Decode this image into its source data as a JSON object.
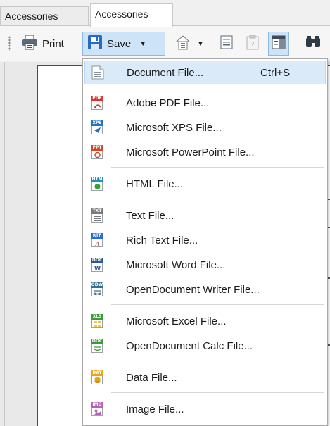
{
  "tabs": [
    {
      "label": "Accessories",
      "active": false
    },
    {
      "label": "Accessories",
      "active": true
    }
  ],
  "toolbar": {
    "print_label": "Print",
    "save_label": "Save",
    "icons": [
      "printer-icon",
      "save-disk-icon",
      "chevron-down-icon",
      "export-home-icon",
      "chevron-down-icon",
      "document-view-icon",
      "paste-icon",
      "page-layout-icon",
      "find-binoculars-icon"
    ]
  },
  "colors": {
    "accent_hover": "#dbeaf9",
    "accent_border": "#8fb8e0",
    "pdf": "#d9342b",
    "xps": "#1e72c9",
    "ppt": "#d24726",
    "htm": "#1f8fc4",
    "txt": "#7a7a7a",
    "rtf": "#2d6bd1",
    "doc": "#2b5797",
    "odw": "#3c6e91",
    "xls": "#3d9a3a",
    "odc": "#3d9a3a",
    "dat": "#e8a317",
    "img": "#b85fb6"
  },
  "save_menu": {
    "items": [
      {
        "label": "Document File...",
        "shortcut": "Ctrl+S",
        "icon": "document-file-icon",
        "tag": ""
      },
      {
        "label": "Adobe PDF File...",
        "shortcut": "",
        "icon": "pdf-file-icon",
        "tag": "PDF"
      },
      {
        "label": "Microsoft XPS File...",
        "shortcut": "",
        "icon": "xps-file-icon",
        "tag": "XPS"
      },
      {
        "label": "Microsoft PowerPoint File...",
        "shortcut": "",
        "icon": "powerpoint-file-icon",
        "tag": "PPT"
      },
      {
        "label": "HTML File...",
        "shortcut": "",
        "icon": "html-file-icon",
        "tag": "HTM"
      },
      {
        "label": "Text File...",
        "shortcut": "",
        "icon": "text-file-icon",
        "tag": "TXT"
      },
      {
        "label": "Rich Text File...",
        "shortcut": "",
        "icon": "rich-text-file-icon",
        "tag": "RTF"
      },
      {
        "label": "Microsoft Word File...",
        "shortcut": "",
        "icon": "word-file-icon",
        "tag": "DOC"
      },
      {
        "label": "OpenDocument Writer File...",
        "shortcut": "",
        "icon": "odt-writer-file-icon",
        "tag": "ODW"
      },
      {
        "label": "Microsoft Excel File...",
        "shortcut": "",
        "icon": "excel-file-icon",
        "tag": "XLS"
      },
      {
        "label": "OpenDocument Calc File...",
        "shortcut": "",
        "icon": "ods-calc-file-icon",
        "tag": "ODC"
      },
      {
        "label": "Data File...",
        "shortcut": "",
        "icon": "data-file-icon",
        "tag": "DAT"
      },
      {
        "label": "Image File...",
        "shortcut": "",
        "icon": "image-file-icon",
        "tag": "IMG"
      }
    ]
  }
}
